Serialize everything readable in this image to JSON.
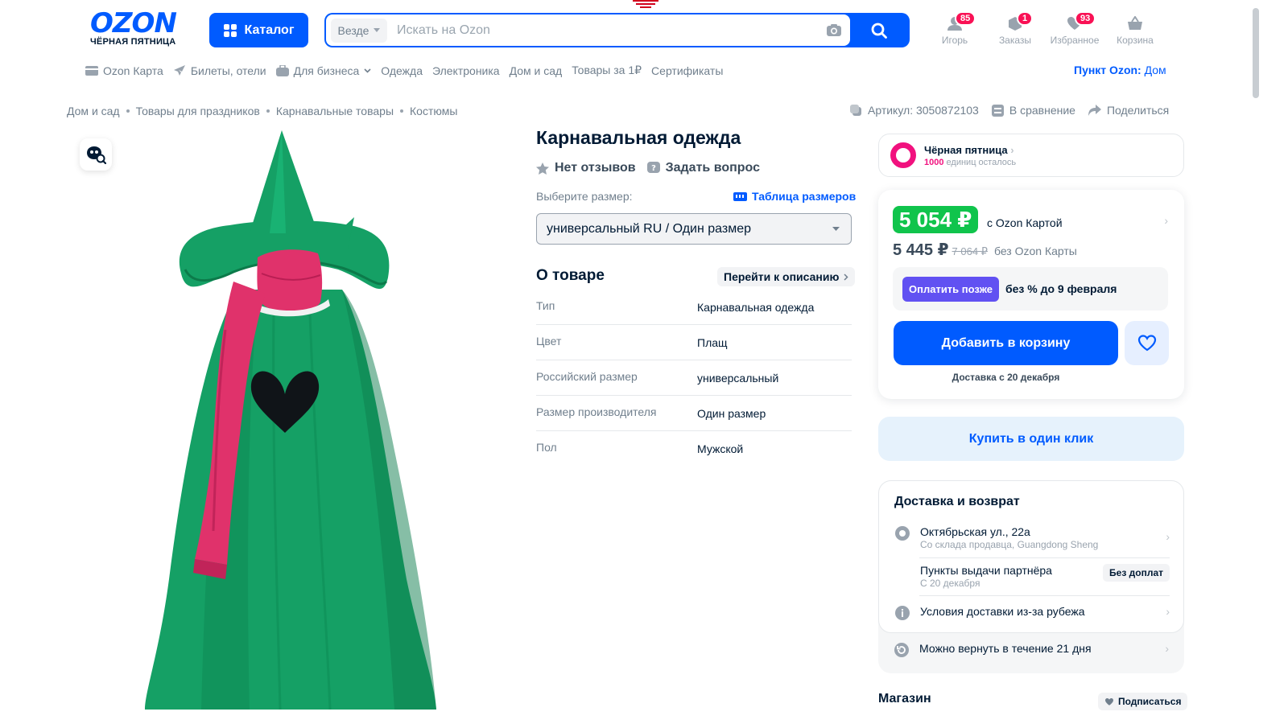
{
  "header": {
    "logo_text": "OZON",
    "logo_sub": "ЧЁРНАЯ ПЯТНИЦА",
    "catalog_label": "Каталог",
    "search": {
      "scope": "Везде",
      "placeholder": "Искать на Ozon"
    },
    "icons": [
      {
        "name": "user-icon",
        "label": "Игорь",
        "badge": "85"
      },
      {
        "name": "orders-icon",
        "label": "Заказы",
        "badge": "1"
      },
      {
        "name": "heart-icon",
        "label": "Избранное",
        "badge": "93"
      },
      {
        "name": "cart-icon",
        "label": "Корзина",
        "badge": ""
      }
    ]
  },
  "topnav": {
    "items": [
      "Ozon Карта",
      "Билеты, отели",
      "Для бизнеса",
      "Одежда",
      "Электроника",
      "Дом и сад",
      "Товары за 1₽",
      "Сертификаты"
    ],
    "pickup_prefix": "Пункт Ozon:",
    "pickup_value": "Дом"
  },
  "breadcrumb": [
    "Дом и сад",
    "Товары для праздников",
    "Карнавальные товары",
    "Костюмы"
  ],
  "meta": {
    "article": "Артикул: 3050872103",
    "compare": "В сравнение",
    "share": "Поделиться"
  },
  "product": {
    "title": "Карнавальная одежда",
    "reviews": "Нет отзывов",
    "ask": "Задать вопрос",
    "size_label": "Выберите размер:",
    "size_table": "Таблица размеров",
    "size_selected": "универсальный RU / Один размер",
    "about_title": "О товаре",
    "goto_desc": "Перейти к описанию",
    "specs": [
      {
        "k": "Тип",
        "v": "Карнавальная одежда"
      },
      {
        "k": "Цвет",
        "v": "Плащ"
      },
      {
        "k": "Российский размер",
        "v": "универсальный"
      },
      {
        "k": "Размер производителя",
        "v": "Один размер"
      },
      {
        "k": "Пол",
        "v": "Мужской"
      }
    ]
  },
  "promo": {
    "title": "Чёрная пятница",
    "count": "1000",
    "rest": "единиц осталось"
  },
  "price": {
    "card_price": "5 054 ₽",
    "card_label": "с Ozon Картой",
    "price": "5 445 ₽",
    "old_price": "7 064 ₽",
    "no_card_label": "без Ozon Карты",
    "pay_later_btn": "Оплатить позже",
    "pay_later_text": "без % до 9 февраля",
    "add_to_cart": "Добавить в корзину",
    "delivery_date": "Доставка с 20 декабря"
  },
  "one_click": "Купить в один клик",
  "delivery": {
    "title": "Доставка и возврат",
    "address": "Октябрьская ул., 22а",
    "address_sub": "Со склада продавца, Guangdong Sheng",
    "partner": "Пункты выдачи партнёра",
    "partner_sub": "С 20 декабря",
    "no_fee": "Без доплат",
    "abroad": "Условия доставки из-за рубежа",
    "return": "Можно вернуть в течение 21 дня"
  },
  "shop": {
    "title": "Магазин",
    "subscribe": "Подписаться"
  },
  "colors": {
    "brand": "#005bff",
    "green": "#10c44c",
    "pink": "#f1117e",
    "badge": "#f91155",
    "purple": "#6151f2"
  }
}
